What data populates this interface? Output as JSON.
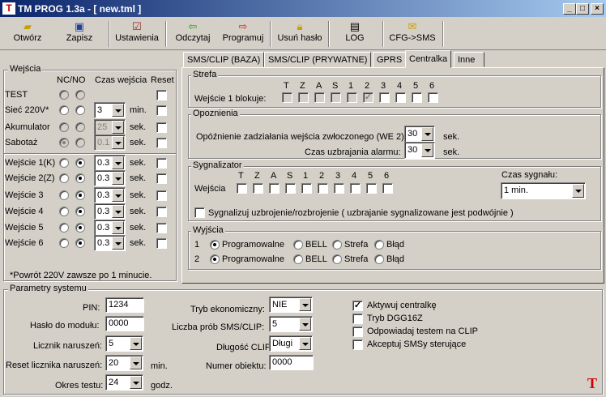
{
  "window": {
    "title": "TM PROG 1.3a - [ new.tml ]",
    "app_icon": "T",
    "buttons": [
      "_",
      "□",
      "×"
    ]
  },
  "toolbar": {
    "buttons": [
      {
        "label": "Otwórz",
        "icon": "open-folder-icon"
      },
      {
        "label": "Zapisz",
        "icon": "floppy-disk-icon"
      },
      {
        "label": "Ustawienia",
        "icon": "settings-icon"
      },
      {
        "label": "Odczytaj",
        "icon": "arrow-left-icon"
      },
      {
        "label": "Programuj",
        "icon": "arrow-right-icon"
      },
      {
        "label": "Usuń hasło",
        "icon": "padlock-icon"
      },
      {
        "label": "LOG",
        "icon": "log-book-icon"
      },
      {
        "label": "CFG->SMS",
        "icon": "envelope-icon"
      }
    ]
  },
  "inputs": {
    "title": "Wejścia",
    "headers": {
      "ncno": "NC/NO",
      "czas": "Czas wejścia",
      "reset": "Reset"
    },
    "rows": [
      {
        "name": "TEST",
        "time": "",
        "unit": "",
        "enabled": false,
        "nc_selected": false
      },
      {
        "name": "Sieć 220V*",
        "time": "3",
        "unit": "min.",
        "enabled": true,
        "nc_selected": false
      },
      {
        "name": "Akumulator",
        "time": "25",
        "unit": "sek.",
        "enabled": false,
        "nc_selected": false
      },
      {
        "name": "Sabotaż",
        "time": "0.1",
        "unit": "sek.",
        "enabled": false,
        "nc_selected": true
      },
      {
        "name": "Wejście 1(K)",
        "time": "0.3",
        "unit": "sek.",
        "enabled": true,
        "nc_selected": false
      },
      {
        "name": "Wejście 2(Z)",
        "time": "0.3",
        "unit": "sek.",
        "enabled": true,
        "nc_selected": false
      },
      {
        "name": "Wejście 3",
        "time": "0.3",
        "unit": "sek.",
        "enabled": true,
        "nc_selected": false
      },
      {
        "name": "Wejście 4",
        "time": "0.3",
        "unit": "sek.",
        "enabled": true,
        "nc_selected": false
      },
      {
        "name": "Wejście 5",
        "time": "0.3",
        "unit": "sek.",
        "enabled": true,
        "nc_selected": false
      },
      {
        "name": "Wejście 6",
        "time": "0.3",
        "unit": "sek.",
        "enabled": true,
        "nc_selected": false
      }
    ],
    "footnote": "*Powrót 220V zawsze po 1 minucie."
  },
  "tabs": [
    "SMS/CLIP (BAZA)",
    "SMS/CLIP (PRYWATNE)",
    "GPRS",
    "Centralka",
    "Inne"
  ],
  "active_tab": "Centralka",
  "strefa": {
    "title": "Strefa",
    "letters": [
      "T",
      "Z",
      "A",
      "S",
      "1",
      "2",
      "3",
      "4",
      "5",
      "6"
    ],
    "row_label": "Wejście 1 blokuje:",
    "checked_index": 5
  },
  "opoznienia": {
    "title": "Opoznienia",
    "entry_label": "Opóźnienie zadziałania wejścia zwłoczonego (WE 2):",
    "entry_value": "30",
    "entry_unit": "sek.",
    "arm_label": "Czas uzbrajania alarmu:",
    "arm_value": "30",
    "arm_unit": "sek."
  },
  "sygnalizator": {
    "title": "Sygnalizator",
    "letters": [
      "T",
      "Z",
      "A",
      "S",
      "1",
      "2",
      "3",
      "4",
      "5",
      "6"
    ],
    "row_label": "Wejścia",
    "time_label": "Czas sygnału:",
    "time_value": "1 min.",
    "signal_label": "Sygnalizuj uzbrojenie/rozbrojenie ( uzbrajanie sygnalizowane jest podwójnie )"
  },
  "wyjscia": {
    "title": "Wyjścia",
    "rows": [
      {
        "num": "1",
        "options": [
          "Programowalne",
          "BELL",
          "Strefa",
          "Błąd"
        ],
        "selected": 0
      },
      {
        "num": "2",
        "options": [
          "Programowalne",
          "BELL",
          "Strefa",
          "Błąd"
        ],
        "selected": 0
      }
    ]
  },
  "params": {
    "title": "Parametry systemu",
    "pin_label": "PIN:",
    "pin": "1234",
    "password_label": "Hasło do modułu:",
    "password": "0000",
    "counter_label": "Licznik naruszeń:",
    "counter": "5",
    "reset_label": "Reset licznika naruszeń:",
    "reset": "20",
    "reset_unit": "min.",
    "test_label": "Okres testu:",
    "test": "24",
    "test_unit": "godz.",
    "eco_label": "Tryb ekonomiczny:",
    "eco": "NIE",
    "tries_label": "Liczba prób SMS/CLIP:",
    "tries": "5",
    "clip_label": "Długość CLIP:",
    "clip": "Długi",
    "obj_label": "Numer obiektu:",
    "obj": "0000",
    "checks": [
      {
        "label": "Aktywuj centralkę",
        "checked": true
      },
      {
        "label": "Tryb DGG16Z",
        "checked": false
      },
      {
        "label": "Odpowiadaj testem na CLIP",
        "checked": false
      },
      {
        "label": "Akceptuj SMSy sterujące",
        "checked": false
      }
    ]
  },
  "logo": "T"
}
